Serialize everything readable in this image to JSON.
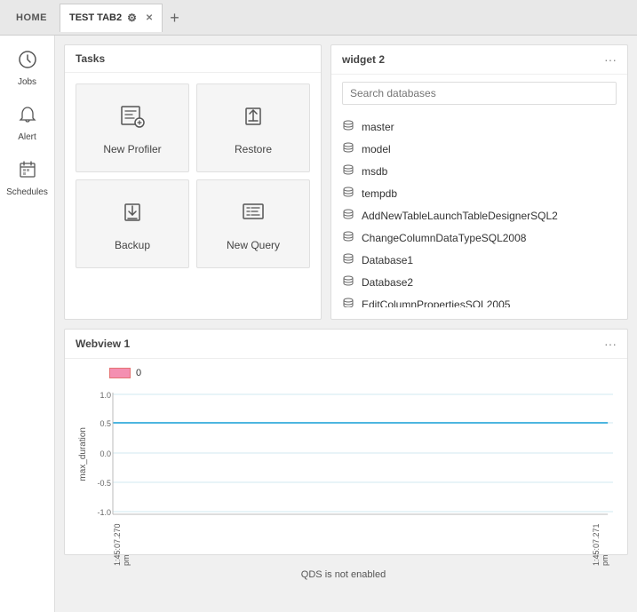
{
  "topbar": {
    "home_label": "HOME",
    "tab_label": "TEST TAB2",
    "tab_pin_icon": "📌",
    "tab_close_icon": "✕",
    "tab_add_icon": "+"
  },
  "sidebar": {
    "items": [
      {
        "id": "jobs",
        "icon": "⚙",
        "label": "Jobs"
      },
      {
        "id": "alert",
        "icon": "🔔",
        "label": "Alert"
      },
      {
        "id": "schedules",
        "icon": "📅",
        "label": "Schedules"
      }
    ]
  },
  "tasks_widget": {
    "title": "Tasks",
    "items": [
      {
        "id": "new-profiler",
        "icon": "profiler",
        "label": "New Profiler"
      },
      {
        "id": "restore",
        "icon": "restore",
        "label": "Restore"
      },
      {
        "id": "backup",
        "icon": "backup",
        "label": "Backup"
      },
      {
        "id": "new-query",
        "icon": "query",
        "label": "New Query"
      }
    ]
  },
  "db_widget": {
    "title": "widget 2",
    "menu_icon": "···",
    "search_placeholder": "Search databases",
    "databases": [
      "master",
      "model",
      "msdb",
      "tempdb",
      "AddNewTableLaunchTableDesignerSQL2",
      "ChangeColumnDataTypeSQL2008",
      "Database1",
      "Database2",
      "EditColumnPropertiesSQL2005"
    ]
  },
  "webview_widget": {
    "title": "Webview 1",
    "menu_icon": "···",
    "legend_label": "0",
    "y_axis_label": "max_duration",
    "y_ticks": [
      "1.0",
      "0.5",
      "0.0",
      "-0.5",
      "-1.0"
    ],
    "x_label_left": "1:45:07.270 pm",
    "x_label_right": "1:45:07.271 pm",
    "footer_text": "QDS is not enabled",
    "chart_line_value": "0.5"
  }
}
